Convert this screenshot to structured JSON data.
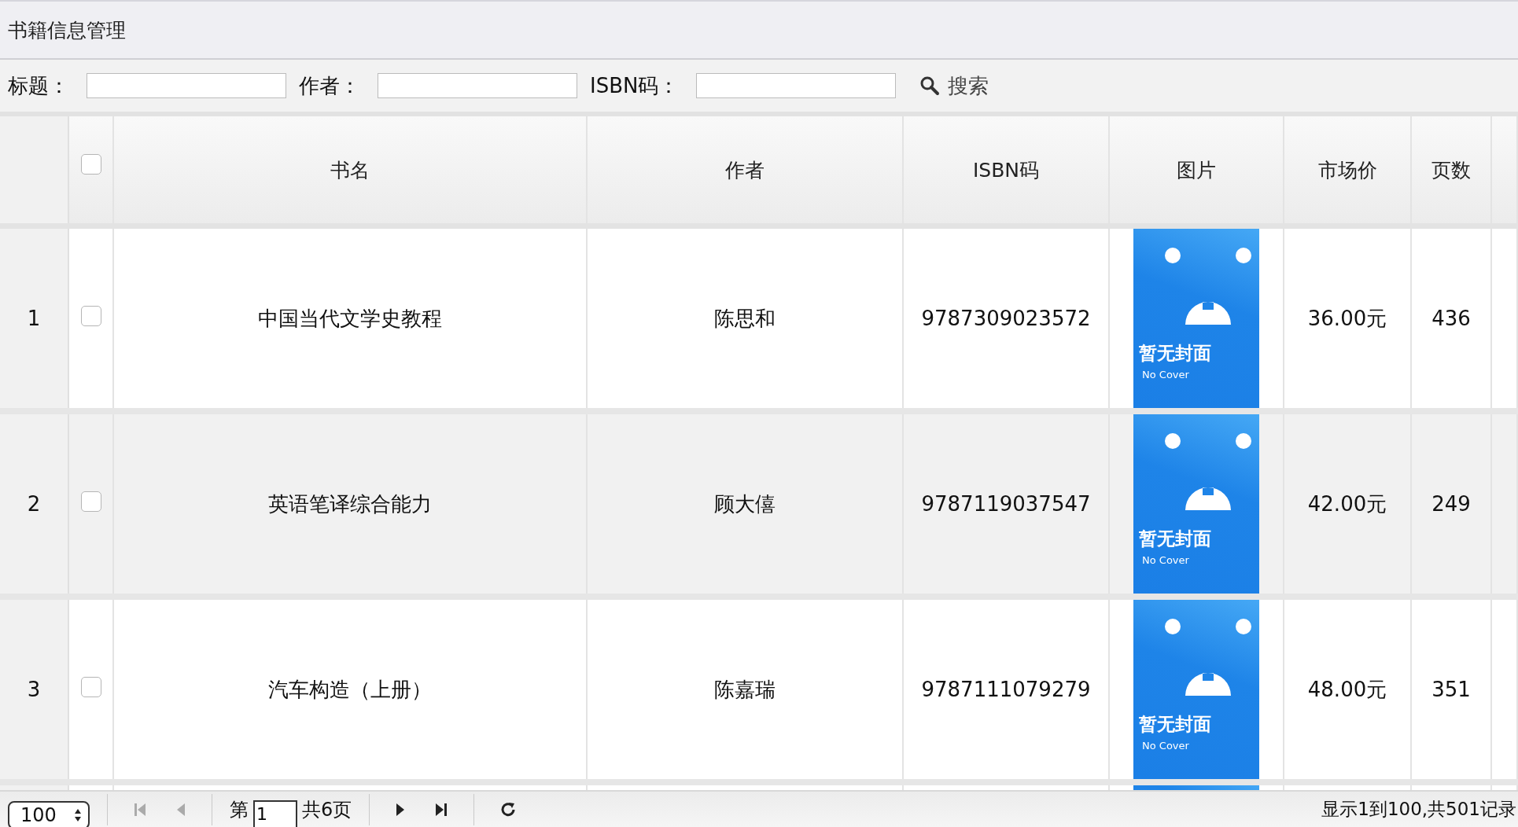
{
  "panel": {
    "title": "书籍信息管理"
  },
  "search": {
    "fields": [
      {
        "label": "标题："
      },
      {
        "label": "作者："
      },
      {
        "label": "ISBN码："
      }
    ],
    "button": "搜索"
  },
  "table": {
    "header_checkbox": {
      "checked": false
    },
    "columns": [
      "书名",
      "作者",
      "ISBN码",
      "图片",
      "市场价",
      "页数"
    ],
    "rows": [
      {
        "index": "1",
        "checked": false,
        "title": "中国当代文学史教程",
        "author": "陈思和",
        "isbn": "9787309023572",
        "cover_title": "暂无封面",
        "cover_subtitle": "No Cover",
        "price": "36.00元",
        "pages": "436"
      },
      {
        "index": "2",
        "checked": false,
        "title": "英语笔译综合能力",
        "author": "顾大僖",
        "isbn": "9787119037547",
        "cover_title": "暂无封面",
        "cover_subtitle": "No Cover",
        "price": "42.00元",
        "pages": "249"
      },
      {
        "index": "3",
        "checked": false,
        "title": "汽车构造（上册）",
        "author": "陈嘉瑞",
        "isbn": "9787111079279",
        "cover_title": "暂无封面",
        "cover_subtitle": "No Cover",
        "price": "48.00元",
        "pages": "351"
      }
    ]
  },
  "pager": {
    "page_size": "100",
    "page_prefix": "第",
    "page": "1",
    "page_total": "共6页",
    "summary": "显示1到100,共501记录"
  }
}
